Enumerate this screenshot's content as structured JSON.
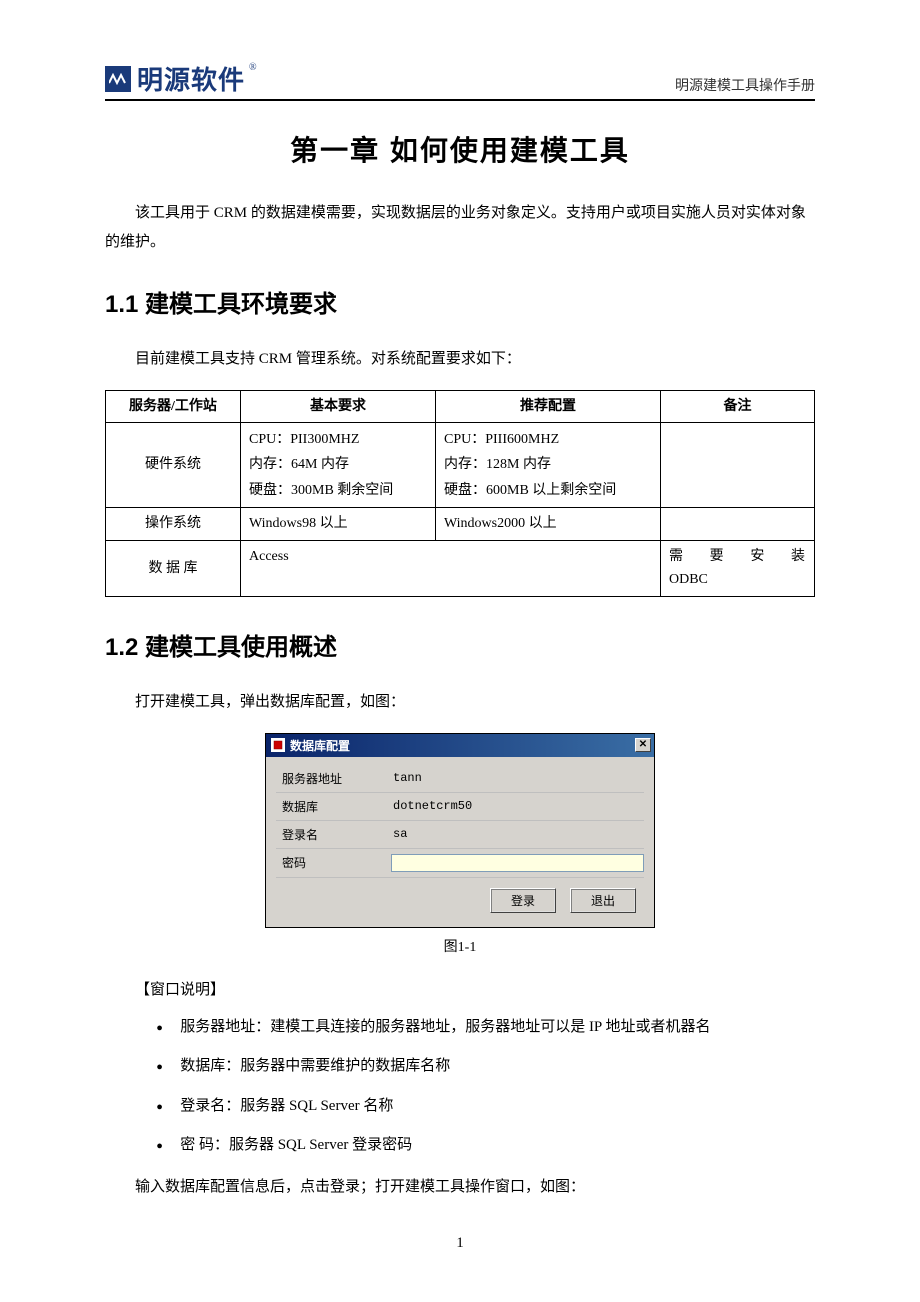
{
  "header": {
    "logo_text": "明源软件",
    "subtitle": "明源建模工具操作手册"
  },
  "chapter": {
    "title": "第一章  如何使用建模工具",
    "intro": "该工具用于 CRM 的数据建模需要，实现数据层的业务对象定义。支持用户或项目实施人员对实体对象的维护。"
  },
  "section_1_1": {
    "heading": "1.1  建模工具环境要求",
    "intro": "目前建模工具支持 CRM 管理系统。对系统配置要求如下：",
    "table": {
      "headers": [
        "服务器/工作站",
        "基本要求",
        "推荐配置",
        "备注"
      ],
      "rows": [
        {
          "label": "硬件系统",
          "basic": [
            "CPU：PII300MHZ",
            "内存：64M 内存",
            "硬盘：300MB 剩余空间"
          ],
          "recommended": [
            "CPU：PIII600MHZ",
            "内存：128M 内存",
            "硬盘：600MB 以上剩余空间"
          ],
          "notes": ""
        },
        {
          "label": "操作系统",
          "basic": [
            "Windows98 以上"
          ],
          "recommended": [
            "Windows2000 以上"
          ],
          "notes": ""
        },
        {
          "label": "数 据 库",
          "basic_span": "Access",
          "notes_lines": [
            "需要安装",
            "ODBC"
          ]
        }
      ]
    }
  },
  "section_1_2": {
    "heading": "1.2  建模工具使用概述",
    "intro": "打开建模工具，弹出数据库配置，如图：",
    "dialog": {
      "title": "数据库配置",
      "fields": {
        "server": {
          "label": "服务器地址",
          "value": "tann"
        },
        "database": {
          "label": "数据库",
          "value": "dotnetcrm50"
        },
        "login": {
          "label": "登录名",
          "value": "sa"
        },
        "password": {
          "label": "密码",
          "value": ""
        }
      },
      "buttons": {
        "login": "登录",
        "exit": "退出"
      }
    },
    "figure_caption": "图1-1",
    "window_desc_heading": "【窗口说明】",
    "bullets": [
      "服务器地址：建模工具连接的服务器地址，服务器地址可以是 IP 地址或者机器名",
      "数据库：服务器中需要维护的数据库名称",
      "登录名：服务器 SQL Server 名称",
      "密  码：服务器 SQL Server 登录密码"
    ],
    "after_list": "输入数据库配置信息后，点击登录；打开建模工具操作窗口，如图："
  },
  "page_number": "1"
}
